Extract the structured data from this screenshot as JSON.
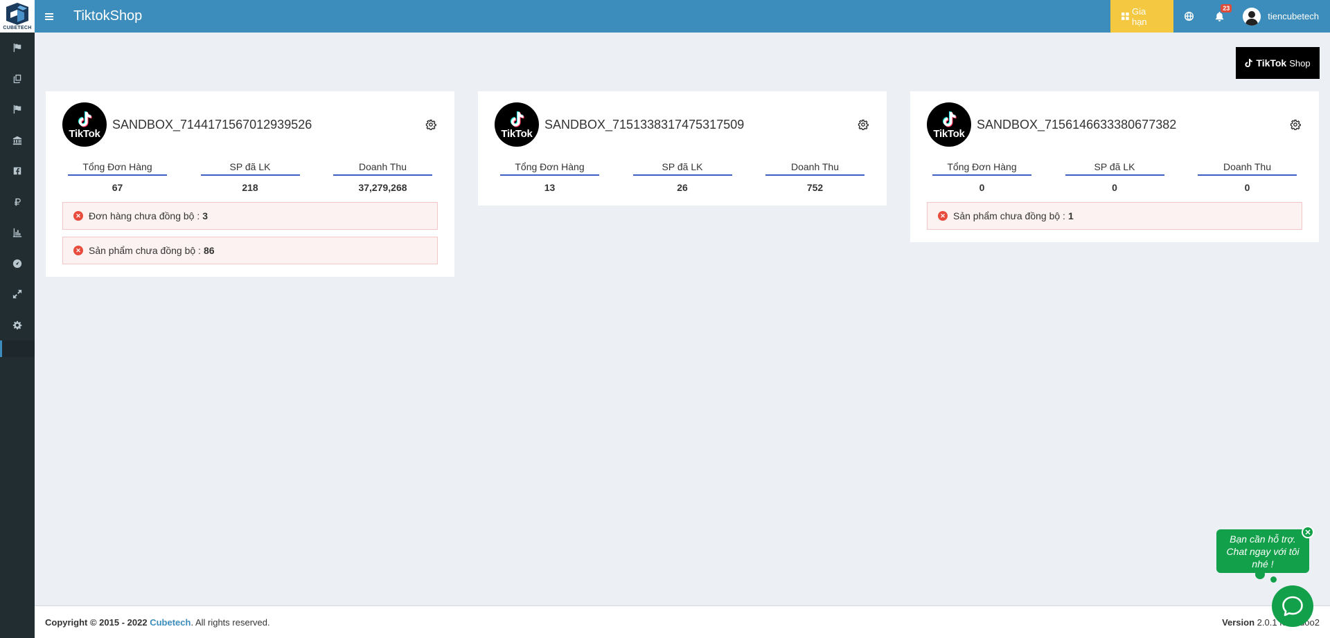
{
  "brand": {
    "logo_text": "CUBETECH"
  },
  "header": {
    "title": "TiktokShop",
    "renew_label": "Gia hạn",
    "notification_count": "23",
    "username": "tiencubetech"
  },
  "tiktok_shop_logo": {
    "brand": "TikTok",
    "shop": "Shop"
  },
  "shops": [
    {
      "avatar_label": "TikTok",
      "name": "SANDBOX_7144171567012939526",
      "stats": [
        {
          "label": "Tổng Đơn Hàng",
          "value": "67"
        },
        {
          "label": "SP đã LK",
          "value": "218"
        },
        {
          "label": "Doanh Thu",
          "value": "37,279,268"
        }
      ],
      "alerts": [
        {
          "text": "Đơn hàng chưa đồng bộ :",
          "count": "3"
        },
        {
          "text": "Sản phẩm chưa đồng bộ :",
          "count": "86"
        }
      ]
    },
    {
      "avatar_label": "TikTok",
      "name": "SANDBOX_7151338317475317509",
      "stats": [
        {
          "label": "Tổng Đơn Hàng",
          "value": "13"
        },
        {
          "label": "SP đã LK",
          "value": "26"
        },
        {
          "label": "Doanh Thu",
          "value": "752"
        }
      ],
      "alerts": []
    },
    {
      "avatar_label": "TikTok",
      "name": "SANDBOX_7156146633380677382",
      "stats": [
        {
          "label": "Tổng Đơn Hàng",
          "value": "0"
        },
        {
          "label": "SP đã LK",
          "value": "0"
        },
        {
          "label": "Doanh Thu",
          "value": "0"
        }
      ],
      "alerts": [
        {
          "text": "Sản phẩm chưa đồng bộ :",
          "count": "1"
        }
      ]
    }
  ],
  "footer": {
    "copyright_prefix": "Copyright © 2015 - 2022",
    "company": "Cubetech",
    "rights": ". All rights reserved.",
    "version_label": "Version",
    "version_value": "2.0.1 for Odoo2"
  },
  "chat": {
    "bubble_text": "Bạn cần hỗ trợ. Chat ngay với tôi nhé !"
  },
  "colors": {
    "header": "#3c8dbc",
    "sidebar": "#222d32",
    "renew": "#f5c842",
    "chat": "#13a04a",
    "stat_underline": "#3c5dc4",
    "alert_icon": "#e74c3c"
  }
}
